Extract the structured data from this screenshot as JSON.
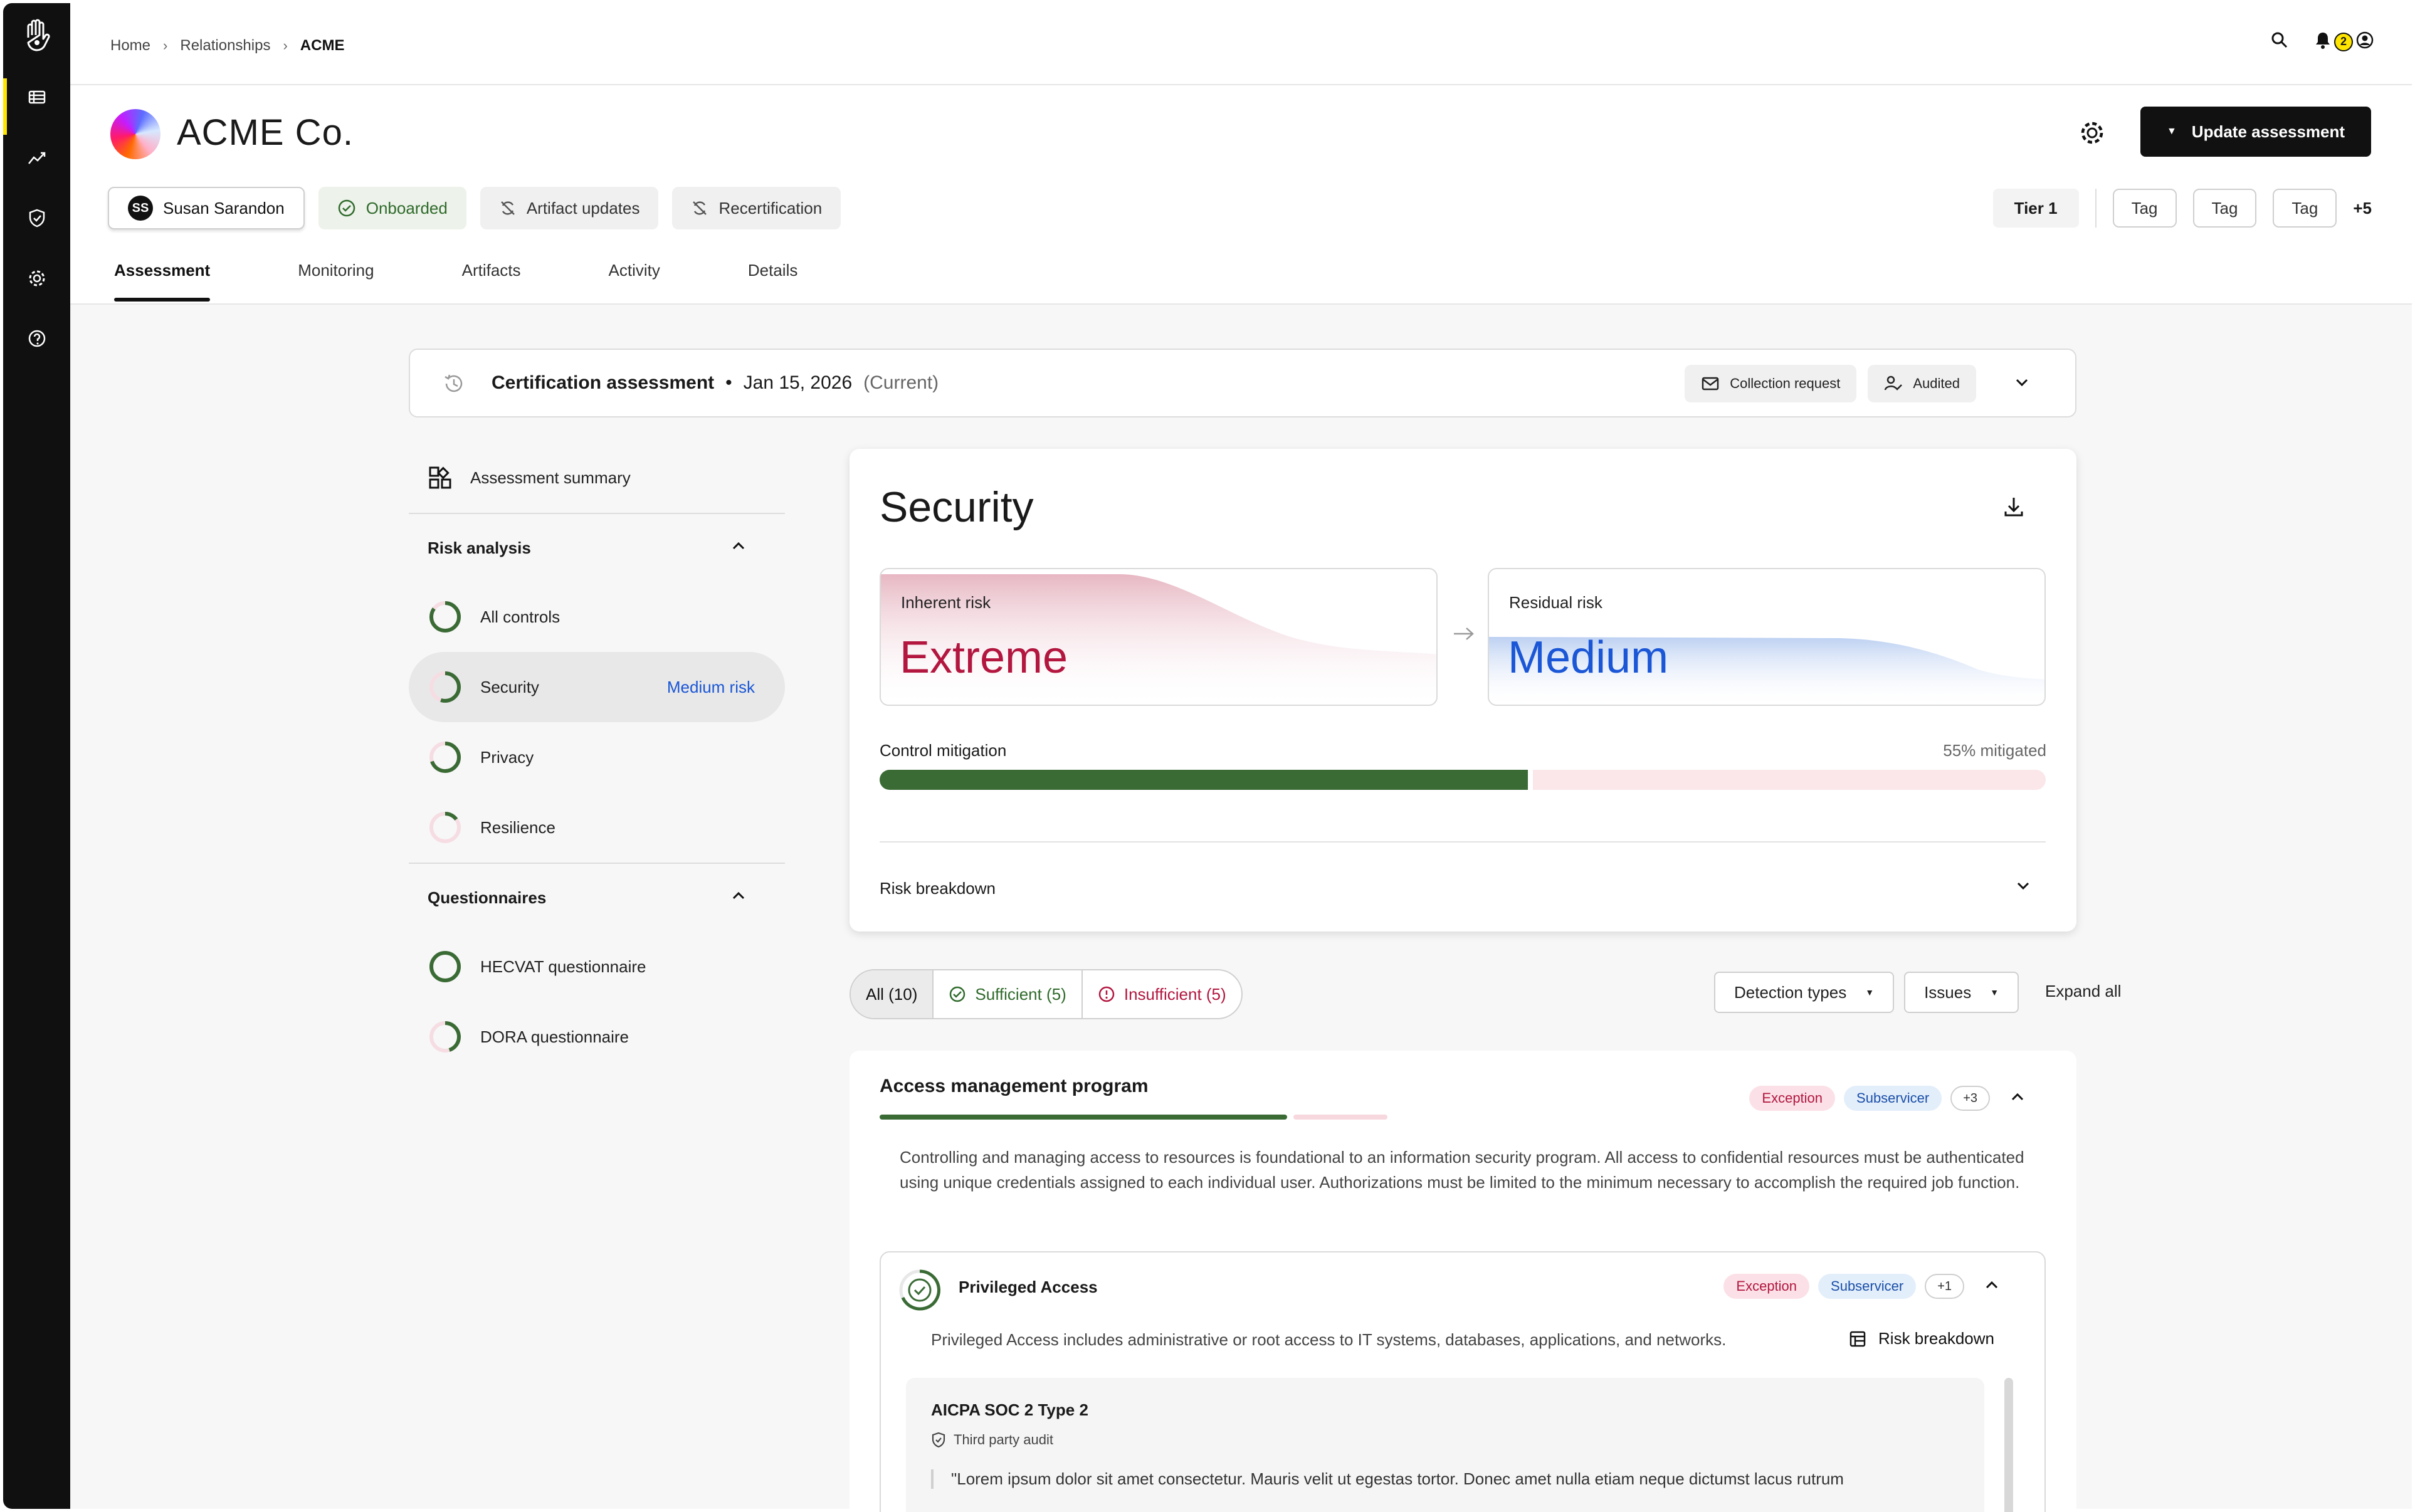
{
  "breadcrumb": {
    "home": "Home",
    "relationships": "Relationships",
    "current": "ACME"
  },
  "notifications": {
    "count": "2"
  },
  "company": {
    "name": "ACME Co."
  },
  "actions": {
    "update_label": "Update assessment"
  },
  "chips": {
    "user_initials": "SS",
    "user_name": "Susan Sarandon",
    "onboarded": "Onboarded",
    "artifact_updates": "Artifact updates",
    "recertification": "Recertification"
  },
  "tags": {
    "tier": "Tier 1",
    "tag1": "Tag",
    "tag2": "Tag",
    "tag3": "Tag",
    "more": "+5"
  },
  "tabs": [
    "Assessment",
    "Monitoring",
    "Artifacts",
    "Activity",
    "Details"
  ],
  "certification": {
    "title": "Certification assessment",
    "dot": "•",
    "date": "Jan 15, 2026",
    "status": "(Current)",
    "collection_request": "Collection request",
    "audited": "Audited"
  },
  "sidebar": {
    "summary": "Assessment summary",
    "risk_analysis": "Risk analysis",
    "risk_items": [
      {
        "label": "All controls",
        "progress": 0.85
      },
      {
        "label": "Security",
        "risk": "Medium risk",
        "progress": 0.55
      },
      {
        "label": "Privacy",
        "progress": 0.7
      },
      {
        "label": "Resilience",
        "progress": 0.15
      }
    ],
    "questionnaires": "Questionnaires",
    "questionnaire_items": [
      {
        "label": "HECVAT questionnaire",
        "progress": 1.0
      },
      {
        "label": "DORA questionnaire",
        "progress": 0.45
      }
    ]
  },
  "security": {
    "title": "Security",
    "inherent_label": "Inherent risk",
    "inherent_value": "Extreme",
    "residual_label": "Residual risk",
    "residual_value": "Medium",
    "mitigation_label": "Control mitigation",
    "mitigation_pct_text": "55% mitigated",
    "mitigation_fraction": 0.56,
    "risk_breakdown": "Risk breakdown"
  },
  "filters": {
    "all": "All (10)",
    "sufficient": "Sufficient (5)",
    "insufficient": "Insufficient (5)",
    "detection_types": "Detection types",
    "issues": "Issues",
    "expand_all": "Expand all"
  },
  "access_program": {
    "title": "Access management program",
    "badge_exception": "Exception",
    "badge_subservicer": "Subservicer",
    "badge_more": "+3",
    "description": "Controlling and managing access to resources is foundational to an information security program. All access to confidential resources must be authenticated using unique credentials assigned to each individual user. Authorizations must be limited to the minimum necessary to accomplish the required job function.",
    "privileged": {
      "title": "Privileged Access",
      "badge_exception": "Exception",
      "badge_subservicer": "Subservicer",
      "badge_more": "+1",
      "description": "Privileged Access includes administrative or root access to IT systems, databases, applications, and networks.",
      "risk_breakdown": "Risk breakdown",
      "evidence": {
        "title": "AICPA SOC 2 Type 2",
        "subtitle": "Third party audit",
        "quote": "\"Lorem ipsum dolor sit amet consectetur. Mauris velit ut egestas tortor. Donec amet nulla etiam neque dictumst lacus rutrum"
      }
    }
  },
  "colors": {
    "accent": "#111111",
    "success": "#3a6b35",
    "danger": "#b3163f",
    "info": "#1a56d6",
    "highlight": "#ffe600"
  }
}
